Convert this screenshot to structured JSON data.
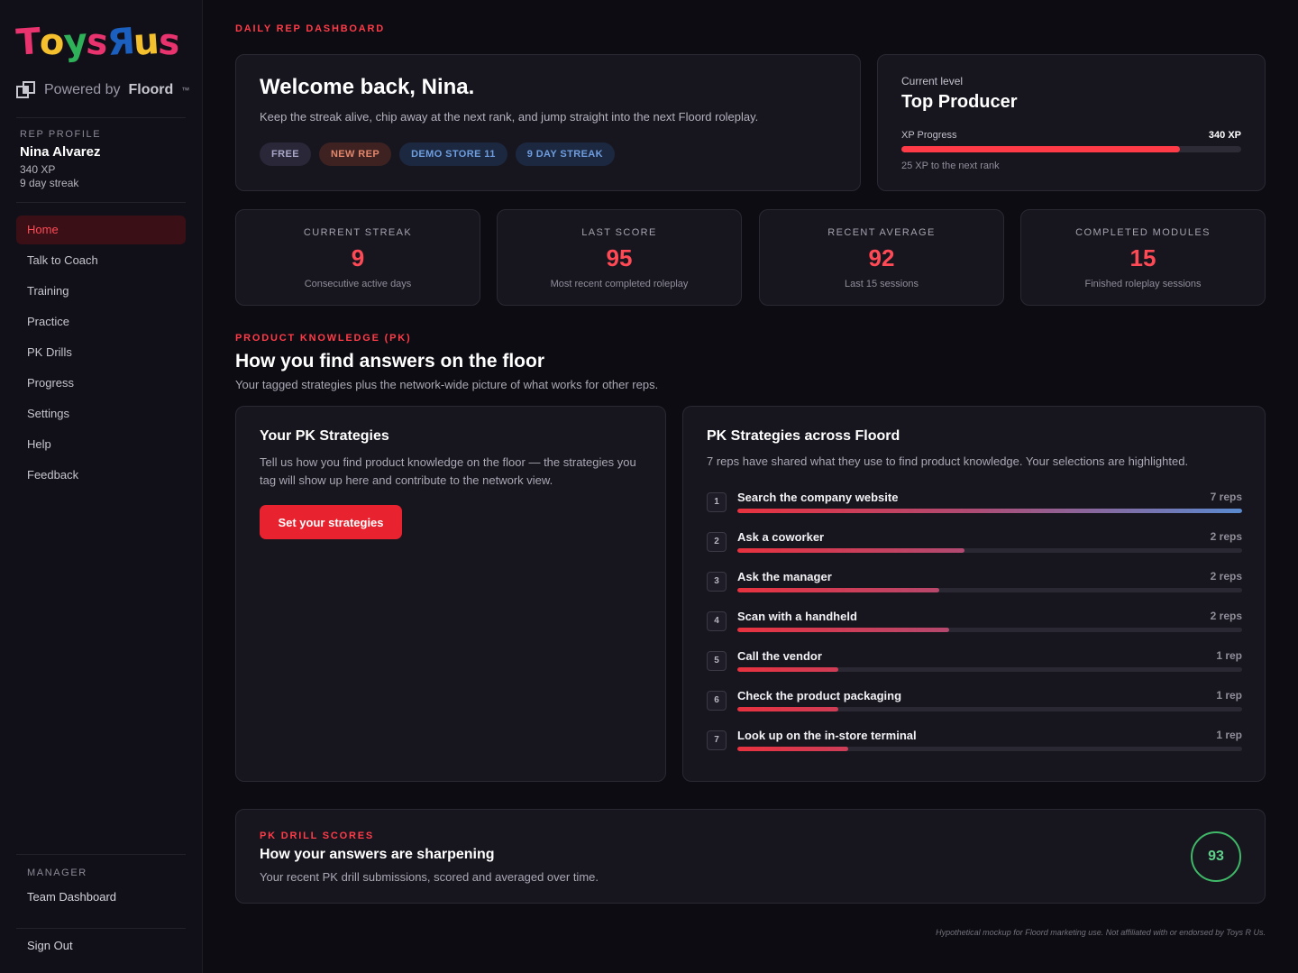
{
  "brand": {
    "logo_text": "ToysRUs",
    "powered_prefix": "Powered by",
    "powered_name": "Floord",
    "powered_tm": "™",
    "colors": {
      "accent": "#ff3b48",
      "logo_pink": "#e8336e",
      "logo_yellow": "#f5c02e",
      "logo_green": "#2fb15a",
      "logo_blue": "#1b5fbf"
    }
  },
  "rep": {
    "caption": "REP PROFILE",
    "name": "Nina Alvarez",
    "xp": "340 XP",
    "streak": "9 day streak"
  },
  "nav": {
    "items": [
      {
        "label": "Home",
        "active": true
      },
      {
        "label": "Talk to Coach",
        "active": false
      },
      {
        "label": "Training",
        "active": false
      },
      {
        "label": "Practice",
        "active": false
      },
      {
        "label": "PK Drills",
        "active": false
      },
      {
        "label": "Progress",
        "active": false
      },
      {
        "label": "Settings",
        "active": false
      },
      {
        "label": "Help",
        "active": false
      },
      {
        "label": "Feedback",
        "active": false
      }
    ],
    "manager_caption": "MANAGER",
    "team_dashboard": "Team Dashboard",
    "sign_out": "Sign Out"
  },
  "header": {
    "eyebrow": "DAILY REP DASHBOARD"
  },
  "welcome": {
    "title": "Welcome back, Nina.",
    "subtitle": "Keep the streak alive, chip away at the next rank, and jump straight into the next Floord roleplay.",
    "badges": [
      "FREE",
      "NEW REP",
      "DEMO STORE 11",
      "9 DAY STREAK"
    ]
  },
  "level": {
    "caption": "Current level",
    "name": "Top Producer",
    "progress_label": "XP Progress",
    "progress_value": "340 XP",
    "progress_fraction": 0.82,
    "next_rank": "25 XP to the next rank"
  },
  "stats": [
    {
      "caption": "CURRENT STREAK",
      "value": "9",
      "sub": "Consecutive active days"
    },
    {
      "caption": "LAST SCORE",
      "value": "95",
      "sub": "Most recent completed roleplay"
    },
    {
      "caption": "RECENT AVERAGE",
      "value": "92",
      "sub": "Last 15 sessions"
    },
    {
      "caption": "COMPLETED MODULES",
      "value": "15",
      "sub": "Finished roleplay sessions"
    }
  ],
  "pk": {
    "eyebrow": "PRODUCT KNOWLEDGE (PK)",
    "title": "How you find answers on the floor",
    "subtitle": "Your tagged strategies plus the network-wide picture of what works for other reps.",
    "yours": {
      "title": "Your PK Strategies",
      "body": "Tell us how you find product knowledge on the floor — the strategies you tag will show up here and contribute to the network view.",
      "button": "Set your strategies"
    },
    "across": {
      "title": "PK Strategies across Floord",
      "subtitle": "7 reps have shared what they use to find product knowledge. Your selections are highlighted.",
      "rows": [
        {
          "rank": "1",
          "label": "Search the company website",
          "count": "7 reps",
          "fraction": 1.0
        },
        {
          "rank": "2",
          "label": "Ask a coworker",
          "count": "2 reps",
          "fraction": 0.45
        },
        {
          "rank": "3",
          "label": "Ask the manager",
          "count": "2 reps",
          "fraction": 0.4
        },
        {
          "rank": "4",
          "label": "Scan with a handheld",
          "count": "2 reps",
          "fraction": 0.42
        },
        {
          "rank": "5",
          "label": "Call the vendor",
          "count": "1 rep",
          "fraction": 0.2
        },
        {
          "rank": "6",
          "label": "Check the product packaging",
          "count": "1 rep",
          "fraction": 0.2
        },
        {
          "rank": "7",
          "label": "Look up on the in-store terminal",
          "count": "1 rep",
          "fraction": 0.22
        }
      ]
    }
  },
  "drill": {
    "eyebrow": "PK DRILL SCORES",
    "title": "How your answers are sharpening",
    "subtitle": "Your recent PK drill submissions, scored and averaged over time.",
    "score": "93"
  },
  "disclaimer": "Hypothetical mockup for Floord marketing use. Not affiliated with or endorsed by Toys R Us."
}
